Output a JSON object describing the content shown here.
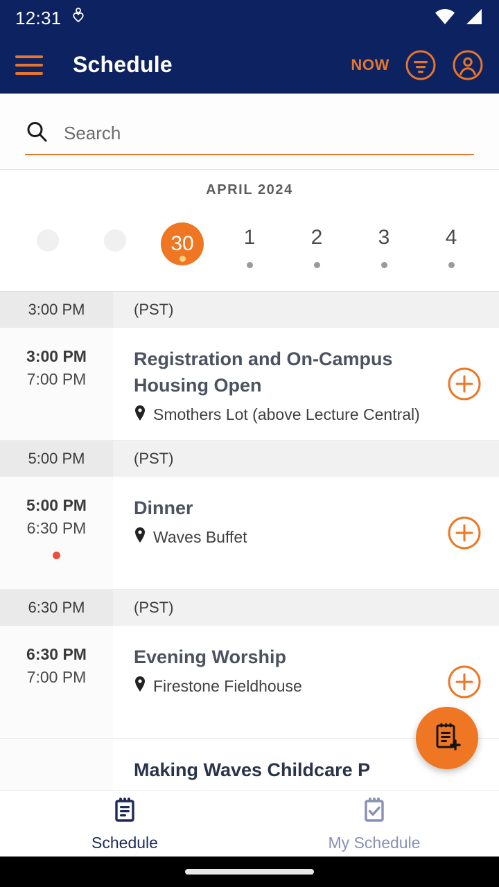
{
  "colors": {
    "brand_navy": "#0d2260",
    "brand_orange": "#ef7622",
    "accent_orange_text": "#e8762a",
    "nav_active": "#1b2a59",
    "nav_inactive": "#8891b4",
    "alert_dot": "#e8503a",
    "selected_day_dot": "#fbd37a"
  },
  "status_bar": {
    "time": "12:31",
    "left_icons": [
      "health-heart-icon"
    ],
    "right_icons": [
      "wifi-icon",
      "cellular-signal-icon"
    ]
  },
  "app_bar": {
    "menu_icon": "hamburger-menu-icon",
    "title": "Schedule",
    "now_label": "NOW",
    "filter_icon": "filter-circle-icon",
    "account_icon": "account-circle-icon"
  },
  "search": {
    "icon": "search-icon",
    "placeholder": "Search",
    "value": ""
  },
  "date_strip": {
    "month_label": "APRIL 2024",
    "days": [
      {
        "label": "",
        "skeleton": true,
        "selected": false,
        "has_dot": false
      },
      {
        "label": "",
        "skeleton": true,
        "selected": false,
        "has_dot": false
      },
      {
        "label": "30",
        "skeleton": false,
        "selected": true,
        "has_dot": true
      },
      {
        "label": "1",
        "skeleton": false,
        "selected": false,
        "has_dot": true
      },
      {
        "label": "2",
        "skeleton": false,
        "selected": false,
        "has_dot": true
      },
      {
        "label": "3",
        "skeleton": false,
        "selected": false,
        "has_dot": true
      },
      {
        "label": "4",
        "skeleton": false,
        "selected": false,
        "has_dot": true
      }
    ]
  },
  "schedule": {
    "groups": [
      {
        "header_time": "3:00 PM",
        "header_timezone": "(PST)",
        "events": [
          {
            "start": "3:00 PM",
            "end": "7:00 PM",
            "title": "Registration and On-Campus Housing Open",
            "location_icon": "location-pin-icon",
            "location": "Smothers Lot (above Lecture Central)",
            "has_alert_dot": false,
            "add_icon": "add-circle-icon"
          }
        ]
      },
      {
        "header_time": "5:00 PM",
        "header_timezone": "(PST)",
        "events": [
          {
            "start": "5:00 PM",
            "end": "6:30 PM",
            "title": "Dinner",
            "location_icon": "location-pin-icon",
            "location": "Waves Buffet",
            "has_alert_dot": true,
            "add_icon": "add-circle-icon"
          }
        ]
      },
      {
        "header_time": "6:30 PM",
        "header_timezone": "(PST)",
        "events": [
          {
            "start": "6:30 PM",
            "end": "7:00 PM",
            "title": "Evening Worship",
            "location_icon": "location-pin-icon",
            "location": "Firestone Fieldhouse",
            "has_alert_dot": false,
            "add_icon": "add-circle-icon"
          }
        ]
      }
    ],
    "partial_next_event": {
      "title": "Making Waves Childcare P",
      "start": ""
    }
  },
  "fab": {
    "icon": "add-to-my-schedule-icon",
    "label": ""
  },
  "bottom_nav": {
    "items": [
      {
        "label": "Schedule",
        "icon": "clipboard-list-icon",
        "active": true
      },
      {
        "label": "My Schedule",
        "icon": "clipboard-check-icon",
        "active": false
      }
    ]
  }
}
